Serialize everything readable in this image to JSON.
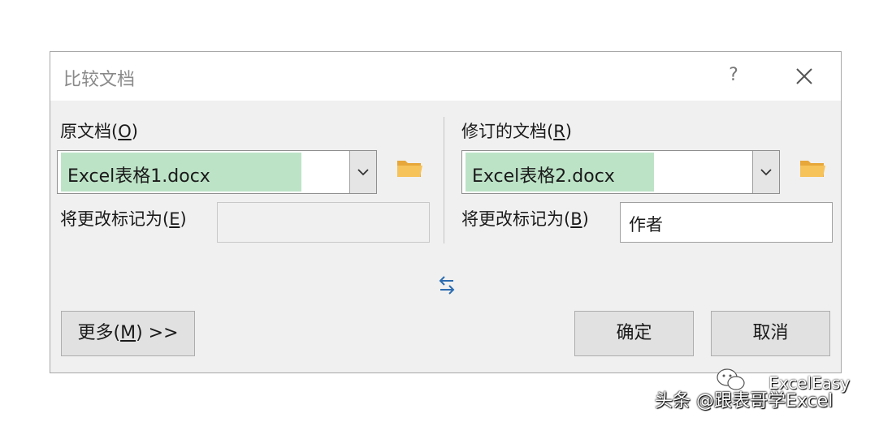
{
  "dialog": {
    "title": "比较文档",
    "help": "?",
    "original": {
      "label_prefix": "原文档(",
      "label_key": "O",
      "label_suffix": ")",
      "selected": "Excel表格1.docx",
      "mark_label_prefix": "将更改标记为(",
      "mark_label_key": "E",
      "mark_label_suffix": ")",
      "mark_value": ""
    },
    "revised": {
      "label_prefix": "修订的文档(",
      "label_key": "R",
      "label_suffix": ")",
      "selected": "Excel表格2.docx",
      "mark_label_prefix": "将更改标记为(",
      "mark_label_key": "B",
      "mark_label_suffix": ")",
      "mark_value": "作者"
    },
    "buttons": {
      "more_prefix": "更多(",
      "more_key": "M",
      "more_suffix": ") >>",
      "ok": "确定",
      "cancel": "取消"
    }
  },
  "watermark": {
    "top": "ExcelEasy",
    "bottom": "头条 @跟表哥学Excel"
  },
  "colors": {
    "highlight": "#bde3c7",
    "swap_arrows": "#2b6cb0",
    "folder": "#f2b84b"
  }
}
